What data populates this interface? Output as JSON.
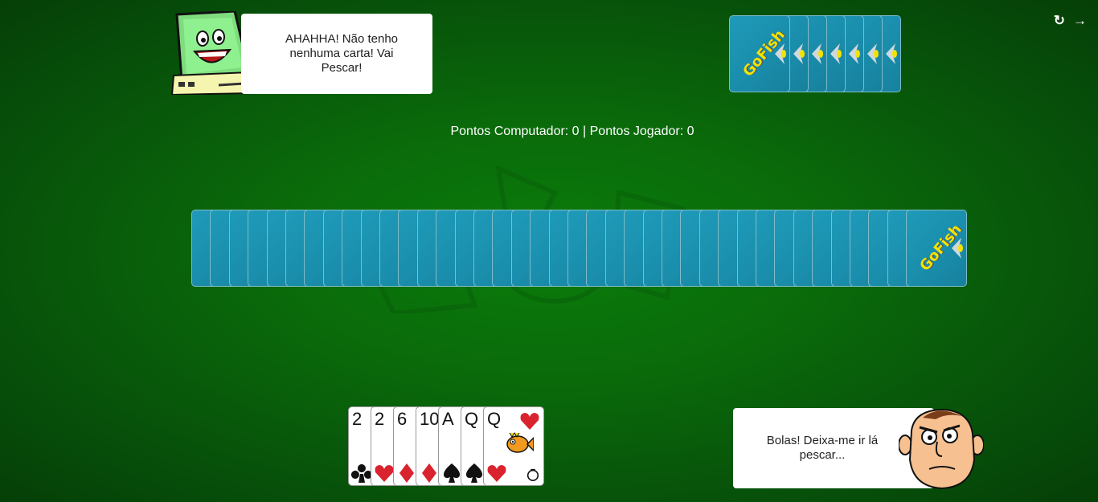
{
  "header": {
    "restart_icon": "refresh-icon",
    "exit_icon": "sign-out-icon"
  },
  "computer": {
    "speech": "AHAHHA! Não tenho nenhuma carta! Vai Pescar!"
  },
  "player": {
    "speech": "Bolas! Deixa-me ir lá pescar..."
  },
  "score_text": "Pontos Computador: 0 | Pontos Jogador: 0",
  "opponent_hand": {
    "count": 7
  },
  "deck": {
    "count": 39
  },
  "card_back_logo": "GoFish",
  "player_hand": [
    {
      "rank": "2",
      "suit": "clubs"
    },
    {
      "rank": "2",
      "suit": "hearts"
    },
    {
      "rank": "6",
      "suit": "diamonds"
    },
    {
      "rank": "10",
      "suit": "diamonds"
    },
    {
      "rank": "A",
      "suit": "spades"
    },
    {
      "rank": "Q",
      "suit": "spades"
    },
    {
      "rank": "Q",
      "suit": "hearts"
    }
  ],
  "colors": {
    "table": "#0a6b0a",
    "card_back": "#1a8fad",
    "red_suit": "#d9232e",
    "black_suit": "#111111",
    "logo": "#f4e200"
  }
}
